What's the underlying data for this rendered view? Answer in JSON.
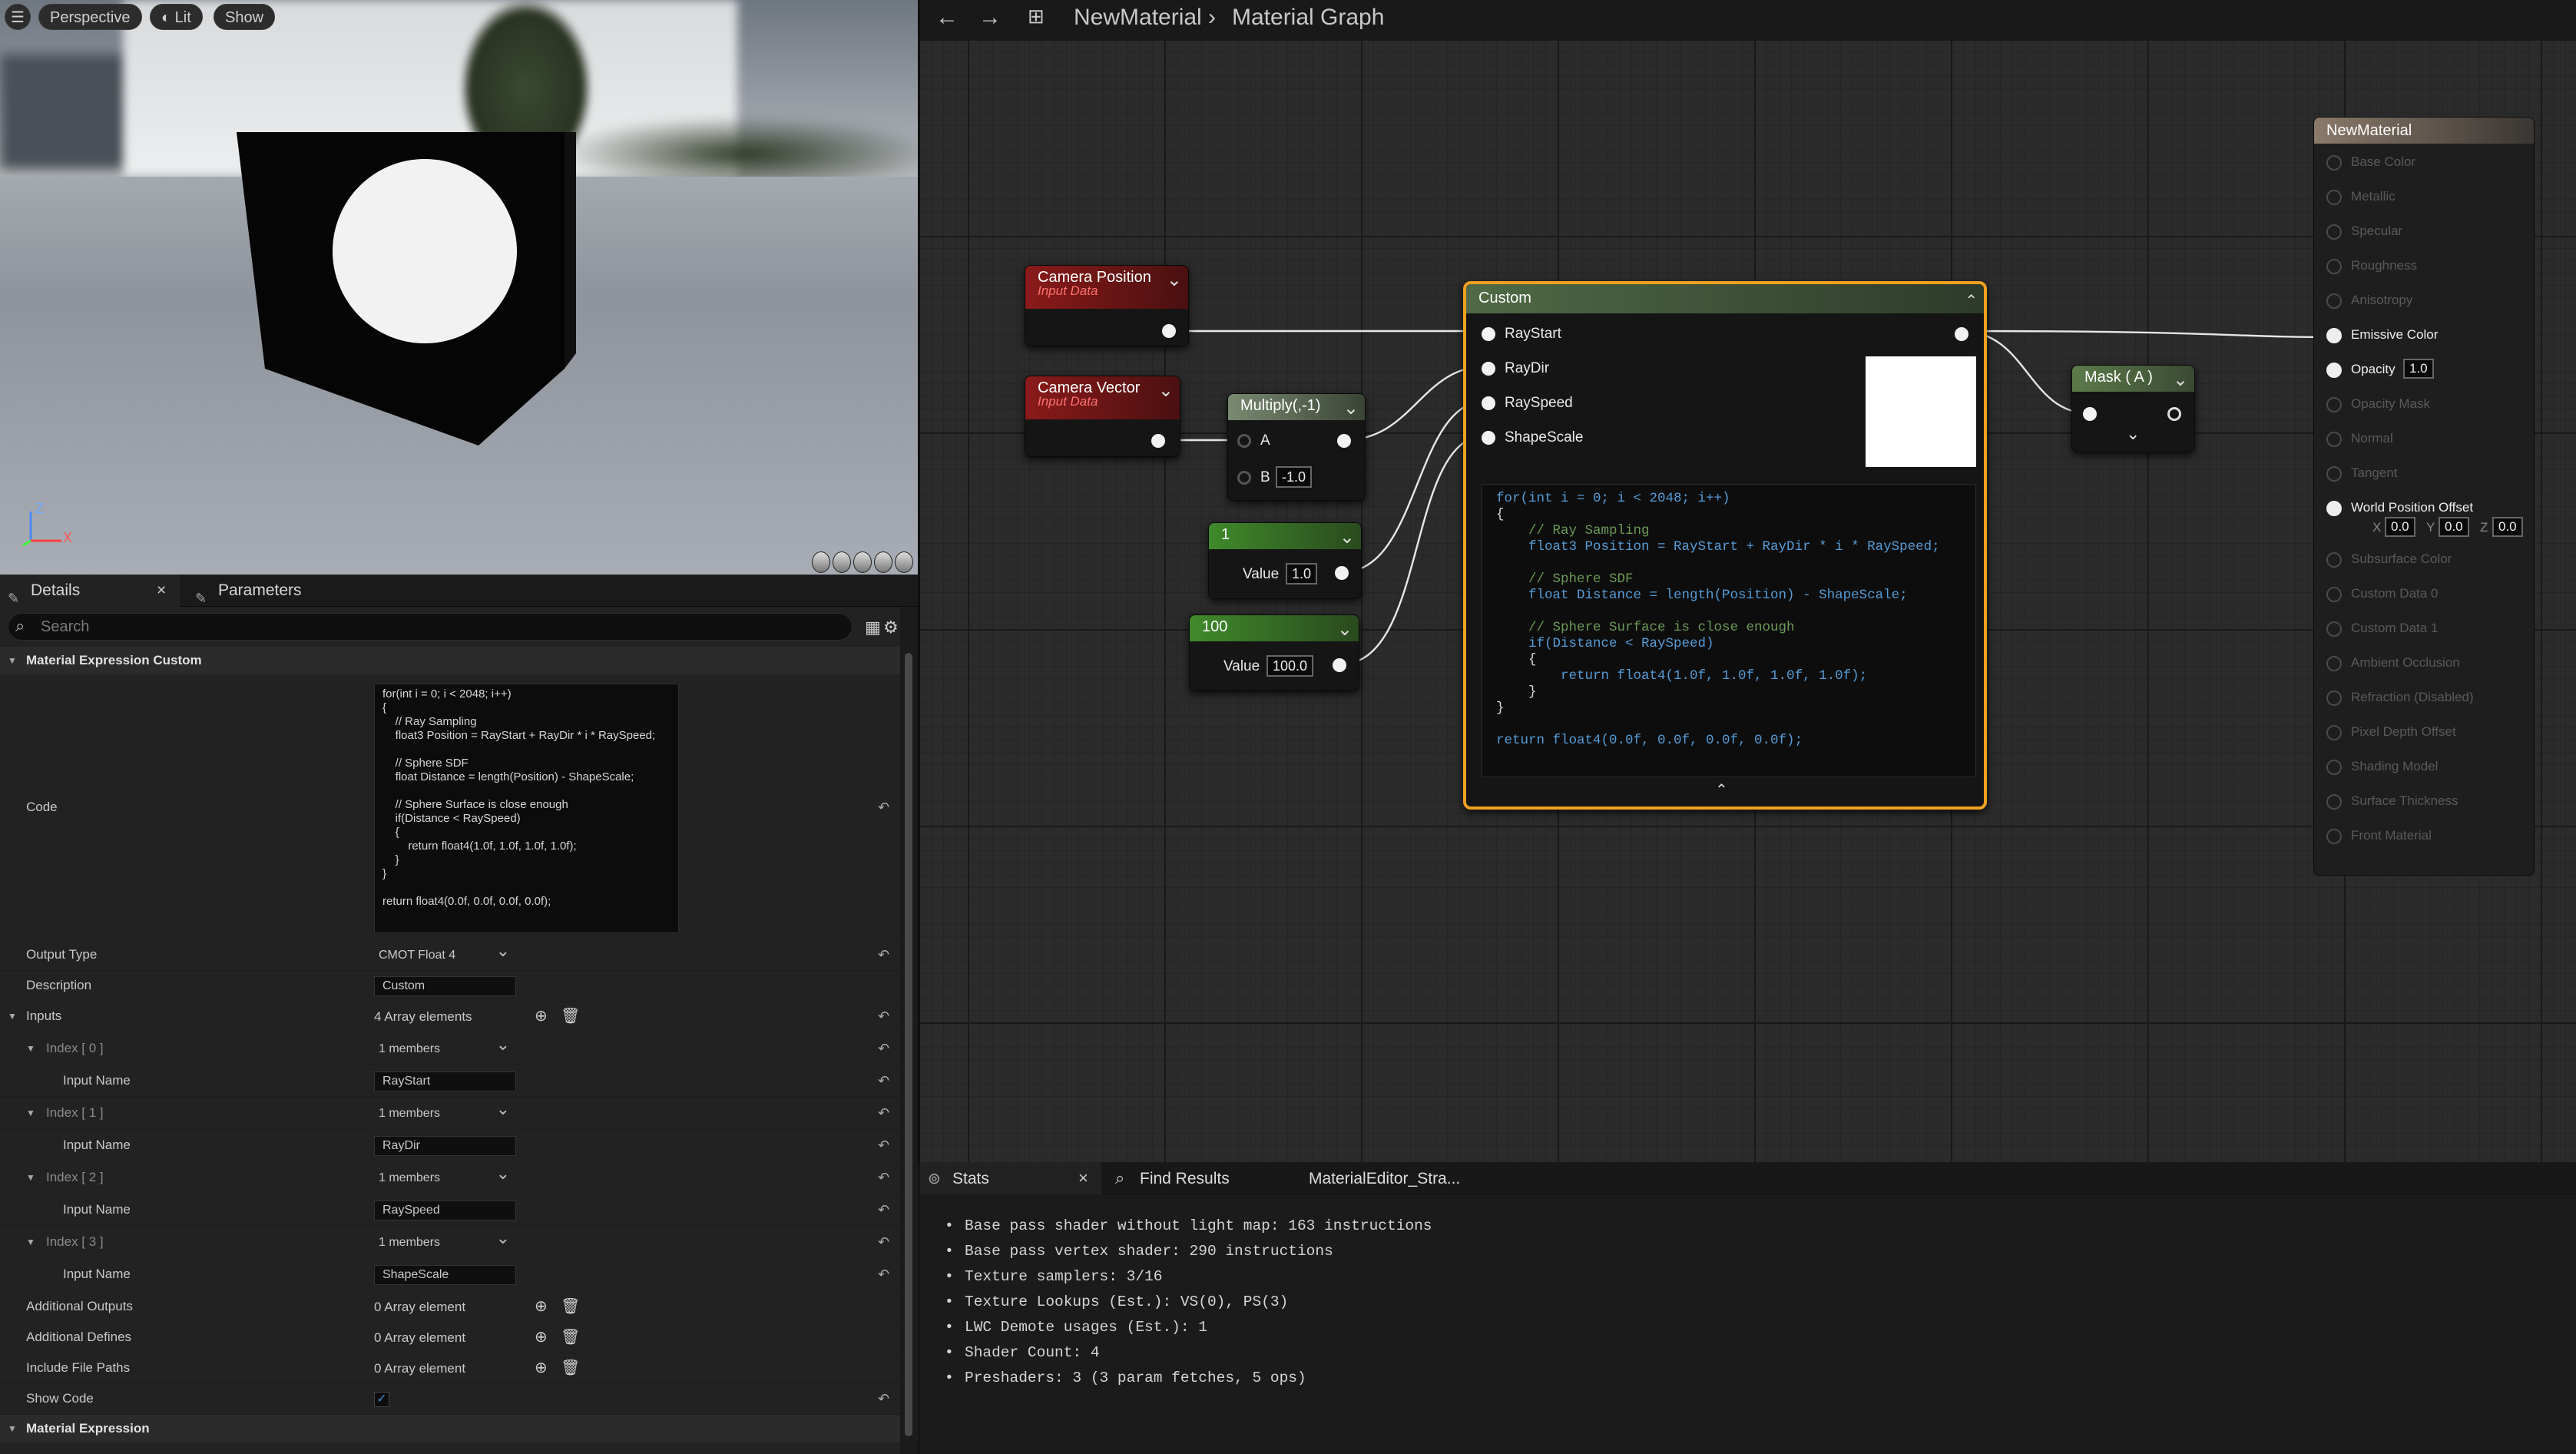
{
  "viewport": {
    "perspective": "Perspective",
    "lit": "Lit",
    "show": "Show",
    "axis_z": "Z",
    "axis_x": "X"
  },
  "tabs": {
    "details": "Details",
    "details_close": "×",
    "parameters": "Parameters"
  },
  "search": {
    "placeholder": "Search"
  },
  "sections": {
    "custom": "Material Expression Custom",
    "expression": "Material Expression"
  },
  "code_lines": [
    "for(int i = 0; i < 2048; i++)",
    "{",
    "    // Ray Sampling",
    "    float3 Position = RayStart + RayDir * i * RaySpeed;",
    "",
    "    // Sphere SDF",
    "    float Distance = length(Position) - ShapeScale;",
    "",
    "    // Sphere Surface is close enough",
    "    if(Distance < RaySpeed)",
    "    {",
    "        return float4(1.0f, 1.0f, 1.0f, 1.0f);",
    "    }",
    "}",
    "",
    "return float4(0.0f, 0.0f, 0.0f, 0.0f);"
  ],
  "props": {
    "code": "Code",
    "output_type": "Output Type",
    "output_type_val": "CMOT Float 4",
    "description": "Description",
    "description_val": "Custom",
    "inputs": "Inputs",
    "inputs_val": "4 Array elements",
    "index0": "Index [ 0 ]",
    "index1": "Index [ 1 ]",
    "index2": "Index [ 2 ]",
    "index3": "Index [ 3 ]",
    "members": "1 members",
    "input_name": "Input Name",
    "in0": "RayStart",
    "in1": "RayDir",
    "in2": "RaySpeed",
    "in3": "ShapeScale",
    "add_outputs": "Additional Outputs",
    "add_defines": "Additional Defines",
    "include_paths": "Include File Paths",
    "zero_elem": "0 Array element",
    "show_code": "Show Code"
  },
  "graph": {
    "title": "NewMaterial",
    "crumb_sep": "›",
    "sub": "Material Graph"
  },
  "nodes": {
    "cam_pos": "Camera Position",
    "cam_vec": "Camera Vector",
    "input_data": "Input Data",
    "multiply": "Multiply(,-1)",
    "a": "A",
    "b": "B",
    "b_val": "-1.0",
    "c1": "1",
    "c1_label": "Value",
    "c1_val": "1.0",
    "c100": "100",
    "c100_label": "Value",
    "c100_val": "100.0",
    "custom": "Custom",
    "raystart": "RayStart",
    "raydir": "RayDir",
    "rayspeed": "RaySpeed",
    "shapescale": "ShapeScale",
    "mask": "Mask ( A )"
  },
  "result": {
    "title": "NewMaterial",
    "pins": [
      "Base Color",
      "Metallic",
      "Specular",
      "Roughness",
      "Anisotropy",
      "Emissive Color",
      "Opacity",
      "Opacity Mask",
      "Normal",
      "Tangent",
      "World Position Offset",
      "Subsurface Color",
      "Custom Data 0",
      "Custom Data 1",
      "Ambient Occlusion",
      "Refraction (Disabled)",
      "Pixel Depth Offset",
      "Shading Model",
      "Surface Thickness",
      "Front Material"
    ],
    "opacity_val": "1.0",
    "wpo_x": "X",
    "wpo_y": "Y",
    "wpo_z": "Z",
    "wpo_xv": "0.0",
    "wpo_yv": "0.0",
    "wpo_zv": "0.0"
  },
  "stats": {
    "tab_stats": "Stats",
    "tab_close": "×",
    "tab_find": "Find Results",
    "tab_strata": "MaterialEditor_Stra...",
    "lines": [
      "Base pass shader without light map: 163 instructions",
      "Base pass vertex shader: 290 instructions",
      "Texture samplers: 3/16",
      "Texture Lookups (Est.): VS(0), PS(3)",
      "LWC Demote usages (Est.): 1",
      "Shader Count: 4",
      "Preshaders: 3  (3 param fetches, 5 ops)"
    ]
  },
  "colors": {
    "accent": "#f0a020",
    "input_header": "#8a1a1a",
    "const_header": "#3f8a2a"
  }
}
